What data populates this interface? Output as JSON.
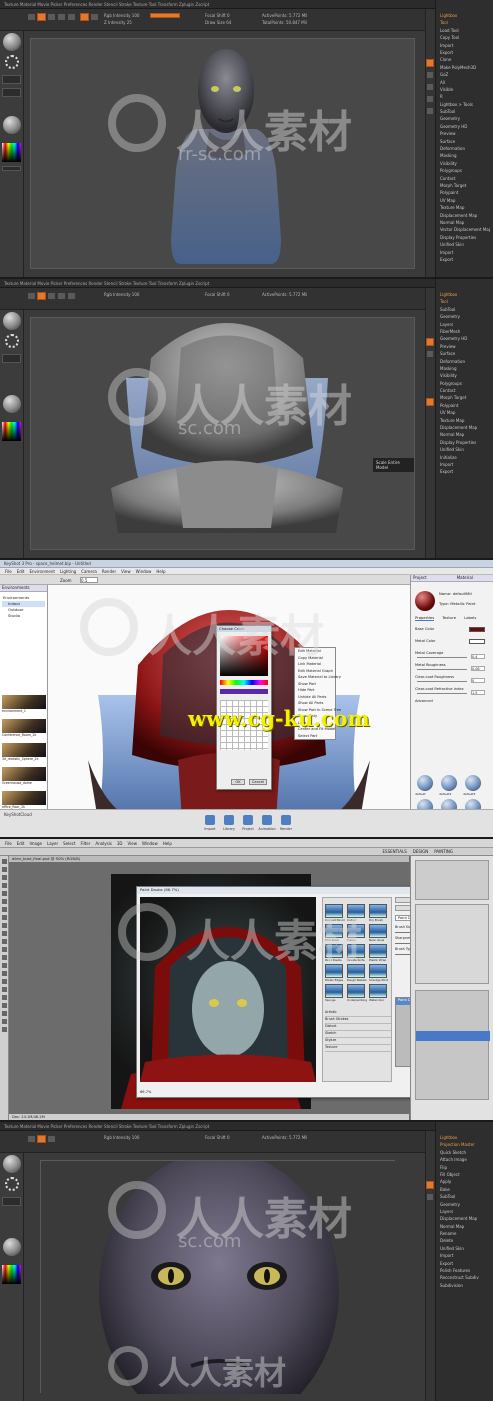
{
  "watermark": {
    "logo_text": "人人素材",
    "sub_text": "rr-sc.com",
    "sub_text_alt": "sc.com",
    "url_text": "www.cg-ku.com"
  },
  "zbrush": {
    "tool_labels": [
      "Mrgb",
      "Rgb",
      "M",
      "Zadd",
      "Zsub",
      "Zcut",
      "Focal Shift 0",
      "Draw Size 64",
      "Dynamic",
      "ActivePoints: 5.772 Mil",
      "TotalPoints: 50.847 Mil"
    ],
    "toolbar_readout": "Rgb Intensity 100",
    "z_intensity": "Z Intensity 25",
    "top_strip": "Texture   Material   Movie   Picker   Preferences   Render   Stencil   Stroke   Texture   Tool   Transform   Zplugin   Zscript",
    "right_menu_1": [
      "Lightbox",
      "Tool",
      "Load Tool",
      "Copy Tool",
      "Import",
      "Export",
      "Clone",
      "Make PolyMesh3D",
      "GoZ",
      "All",
      "Visible",
      "R",
      "Lightbox > Tools",
      "SubTool",
      "Geometry",
      "Geometry HD",
      "Preview",
      "Surface",
      "Deformation",
      "Masking",
      "Visibility",
      "Polygroups",
      "Contact",
      "Morph Target",
      "Polypaint",
      "UV Map",
      "Texture Map",
      "Displacement Map",
      "Normal Map",
      "Vector Displacement Map",
      "Display Properties",
      "Unified Skin",
      "Import",
      "Export"
    ],
    "right_menu_2": [
      "Lightbox",
      "Tool",
      "SubTool",
      "Geometry",
      "Layers",
      "FiberMesh",
      "Geometry HD",
      "Preview",
      "Surface",
      "Deformation",
      "Masking",
      "Visibility",
      "Polygroups",
      "Contact",
      "Morph Target",
      "Polypaint",
      "UV Map",
      "Texture Map",
      "Displacement Map",
      "Normal Map",
      "Display Properties",
      "Unified Skin",
      "Initialize",
      "Import",
      "Export"
    ],
    "tooltip_2": "Scale Entire Model",
    "right_menu_5": [
      "Lightbox",
      "Projection Master",
      "Quick Sketch",
      "Attach Image",
      "Flip",
      "Fill Object",
      "Apply",
      "Bake",
      "SubTool",
      "Geometry",
      "Layers",
      "Displacement Map",
      "Normal Map",
      "Rename",
      "Delete",
      "Unified Skin",
      "Import",
      "Export",
      "Polish Features",
      "Reconstruct Subdiv",
      "Subdivision"
    ],
    "left_labels": [
      "Standard",
      "Dots",
      "Basic Material",
      "Gradient",
      "SwitchColor",
      "Alternate"
    ]
  },
  "keyshot": {
    "title": "KeyShot 3 Pro - space_helmet.bip - Untitled",
    "menu": [
      "File",
      "Edit",
      "Environment",
      "Lighting",
      "Camera",
      "Render",
      "View",
      "Window",
      "Help"
    ],
    "toolbar_zoom": "Zoom",
    "toolbar_value": "0.5",
    "library_tabs": [
      "Library",
      "Environments"
    ],
    "library_tree": [
      "Environments",
      "Indoor",
      "Outdoor",
      "Studio"
    ],
    "environment_items": [
      "environment_1",
      "Conference_Room_2k",
      "3d_realistic_Sphere_2k",
      "Greenhouse_dome",
      "office_floor_2k"
    ],
    "project_label": "Project",
    "material_label": "Material",
    "props_tabs": [
      "Properties",
      "Texture",
      "Labels"
    ],
    "props_name": "Name: defaultMtl",
    "props_type": "Type: Metallic Paint",
    "props_fields": [
      "Base Color",
      "Metal Color",
      "Metal Coverage",
      "Metal Roughness",
      "Clear-coat Roughness",
      "Clear-coat Refractive Index",
      "Advanced"
    ],
    "props_values": [
      "1.0",
      "0.4",
      "0.08",
      "0",
      "1.5"
    ],
    "material_balls": [
      "default",
      "default2",
      "default3",
      "default4",
      "default5",
      "default6"
    ],
    "dock_items": [
      "Import",
      "Library",
      "Project",
      "Animation",
      "Render"
    ],
    "dock_left": "KeyShotCloud",
    "color_dialog_title": "Choose Color",
    "color_dialog_buttons": [
      "OK",
      "Cancel"
    ],
    "context_menu": [
      "Edit Material",
      "Copy Material",
      "Link Material",
      "Edit Material Graph",
      "Save Material to Library",
      "Show Part",
      "Hide Part",
      "Unhide All Parts",
      "Show All Parts",
      "Show Part In Scene Tree",
      "Show Only",
      "Lock All",
      "Center and Fit Model",
      "Select Part"
    ]
  },
  "photoshop": {
    "menu": [
      "File",
      "Edit",
      "Image",
      "Layer",
      "Select",
      "Filter",
      "Analysis",
      "3D",
      "View",
      "Window",
      "Help"
    ],
    "tab_title": "alien_bust_final.psd @ 50% (RGB/8)",
    "dialog_title": "Paint Daubs (66.7%)",
    "dialog_buttons": [
      "OK",
      "Cancel"
    ],
    "filter_label": "Paint Daubs",
    "filter_fields": [
      "Brush Size",
      "Sharpness",
      "Brush Type"
    ],
    "filter_values": [
      "8",
      "7",
      "Simple"
    ],
    "filter_groups": [
      "Artistic",
      "Brush Strokes",
      "Distort",
      "Sketch",
      "Stylize",
      "Texture"
    ],
    "brush_thumbs": [
      "Colored Pencil",
      "Cutout",
      "Dry Brush",
      "Film Grain",
      "Fresco",
      "Neon Glow",
      "Paint Daubs",
      "Palette Knife",
      "Plastic Wrap",
      "Poster Edges",
      "Rough Pastels",
      "Smudge Stick",
      "Sponge",
      "Underpainting",
      "Watercolor"
    ],
    "zoom": "66.7%",
    "workspace_tabs": [
      "ESSENTIALS",
      "DESIGN",
      "PAINTING"
    ],
    "status": "Doc: 24.1M/48.2M"
  },
  "colors": {
    "zbrush_bg": "#3a3a3a",
    "zbrush_accent": "#e4792c",
    "keyshot_bg": "#f0f0f0",
    "photoshop_bg": "#6e6e6e",
    "watermark_yellow": "#f2f200"
  }
}
